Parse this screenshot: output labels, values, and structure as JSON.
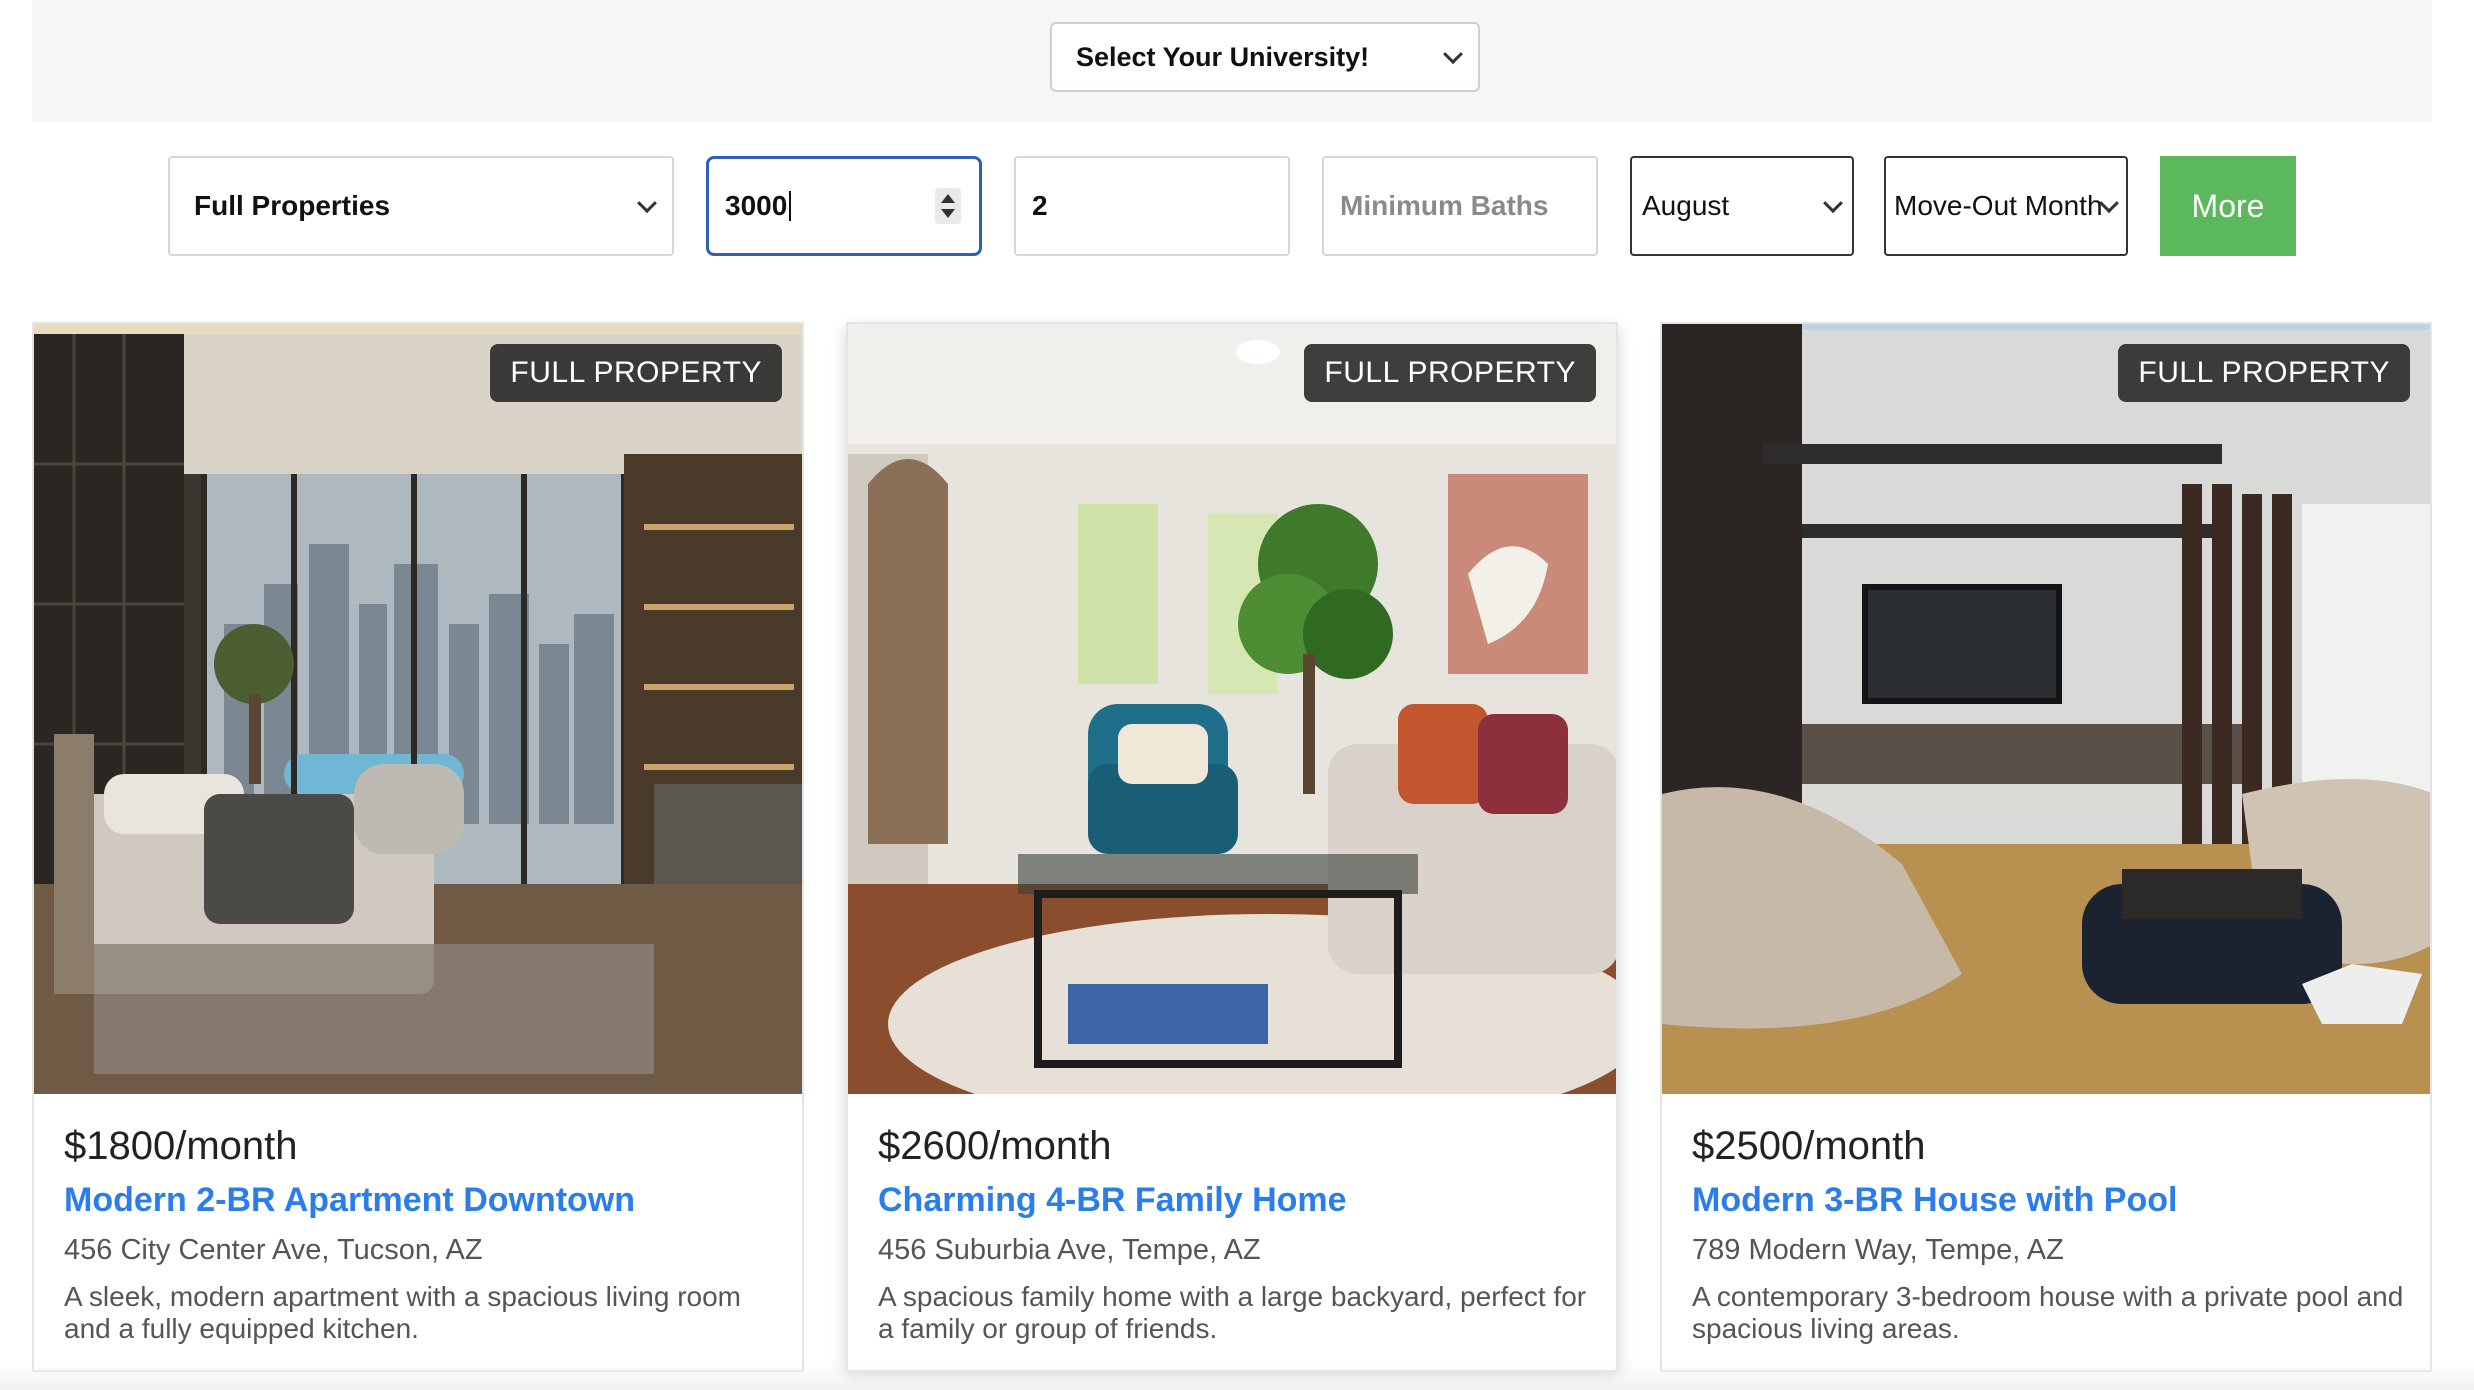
{
  "header": {
    "university_select": "Select Your University!"
  },
  "filters": {
    "property_type": "Full Properties",
    "max_price": "3000",
    "min_beds": "2",
    "min_baths_placeholder": "Minimum Baths",
    "move_in_month": "August",
    "move_out_month": "Move-Out Month",
    "more_label": "More"
  },
  "colors": {
    "accent_button": "#5cb85c",
    "title_link": "#2b7de9",
    "focus_border": "#2f5fb8"
  },
  "listings": [
    {
      "badge": "FULL PROPERTY",
      "price": "$1800/month",
      "title": "Modern 2-BR Apartment Downtown",
      "address": "456 City Center Ave, Tucson, AZ",
      "description": "A sleek, modern apartment with a spacious living room and a fully equipped kitchen."
    },
    {
      "badge": "FULL PROPERTY",
      "price": "$2600/month",
      "title": "Charming 4-BR Family Home",
      "address": "456 Suburbia Ave, Tempe, AZ",
      "description": "A spacious family home with a large backyard, perfect for a family or group of friends."
    },
    {
      "badge": "FULL PROPERTY",
      "price": "$2500/month",
      "title": "Modern 3-BR House with Pool",
      "address": "789 Modern Way, Tempe, AZ",
      "description": "A contemporary 3-bedroom house with a private pool and spacious living areas."
    }
  ]
}
